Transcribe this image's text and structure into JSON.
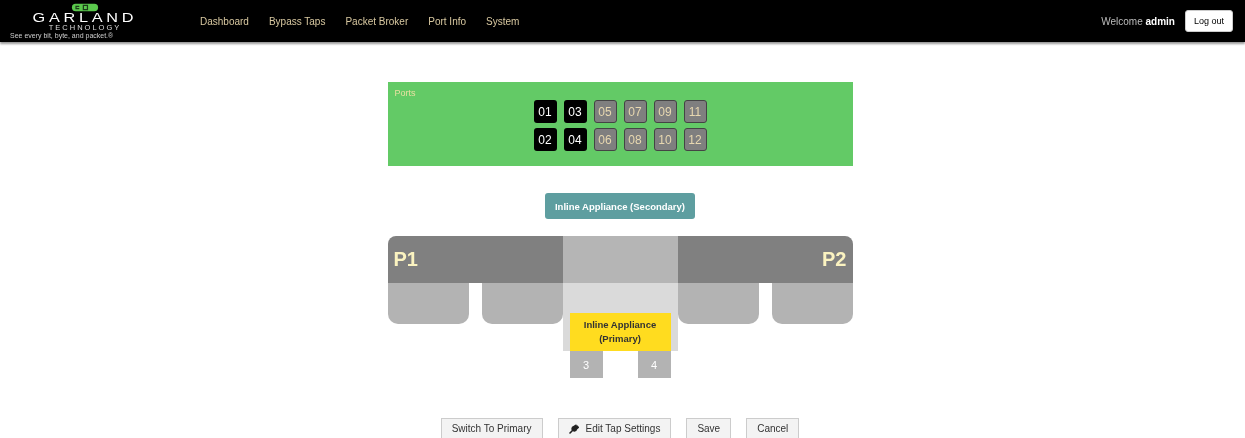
{
  "logo": {
    "name": "GARLAND",
    "subtitle": "TECHNOLOGY",
    "tagline": "See every bit, byte, and packet.®"
  },
  "nav": [
    {
      "label": "Dashboard"
    },
    {
      "label": "Bypass Taps"
    },
    {
      "label": "Packet Broker"
    },
    {
      "label": "Port Info"
    },
    {
      "label": "System"
    }
  ],
  "user": {
    "greeting": "Welcome",
    "name": "admin",
    "logout": "Log out"
  },
  "ports_panel": {
    "title": "Ports",
    "ports": [
      {
        "label": "01",
        "active": true
      },
      {
        "label": "02",
        "active": true
      },
      {
        "label": "03",
        "active": true
      },
      {
        "label": "04",
        "active": true
      },
      {
        "label": "05",
        "active": false
      },
      {
        "label": "06",
        "active": false
      },
      {
        "label": "07",
        "active": false
      },
      {
        "label": "08",
        "active": false
      },
      {
        "label": "09",
        "active": false
      },
      {
        "label": "10",
        "active": false
      },
      {
        "label": "11",
        "active": false
      },
      {
        "label": "12",
        "active": false
      }
    ]
  },
  "secondary_appliance": "Inline Appliance (Secondary)",
  "tap": {
    "left_label": "P1",
    "right_label": "P2",
    "primary_appliance": "Inline Appliance (Primary)",
    "appliance_ports": [
      "3",
      "4"
    ]
  },
  "buttons": [
    {
      "label": "Switch To Primary",
      "kind": "plain"
    },
    {
      "label": "Edit Tap Settings",
      "kind": "wrench"
    },
    {
      "label": "Save",
      "kind": "plain"
    },
    {
      "label": "Cancel",
      "kind": "plain"
    }
  ]
}
